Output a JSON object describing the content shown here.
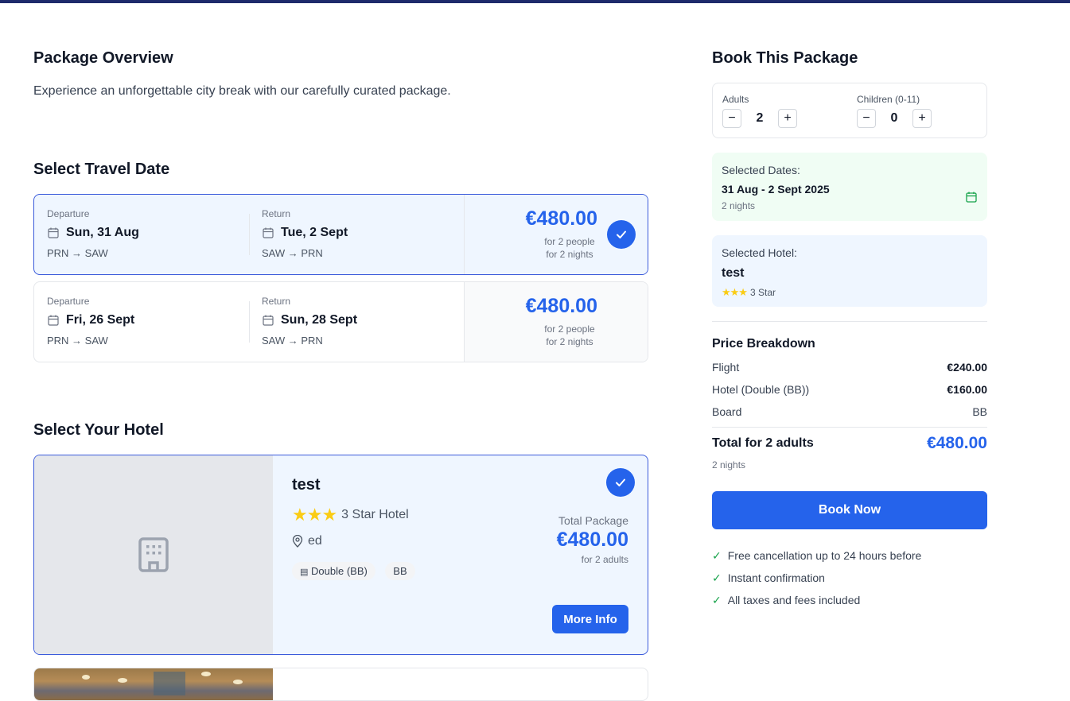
{
  "overview": {
    "title": "Package Overview",
    "description": "Experience an unforgettable city break with our carefully curated package."
  },
  "dates": {
    "title": "Select Travel Date",
    "options": [
      {
        "departure_label": "Departure",
        "departure_date": "Sun, 31 Aug",
        "departure_route": "PRN → SAW",
        "return_label": "Return",
        "return_date": "Tue, 2 Sept",
        "return_route": "SAW → PRN",
        "price": "€480.00",
        "people": "for 2 people",
        "nights": "for 2 nights",
        "selected": true
      },
      {
        "departure_label": "Departure",
        "departure_date": "Fri, 26 Sept",
        "departure_route": "PRN → SAW",
        "return_label": "Return",
        "return_date": "Sun, 28 Sept",
        "return_route": "SAW → PRN",
        "price": "€480.00",
        "people": "for 2 people",
        "nights": "for 2 nights",
        "selected": false
      }
    ]
  },
  "hotels": {
    "title": "Select Your Hotel",
    "items": [
      {
        "name": "test",
        "stars": 3,
        "star_label": "3 Star Hotel",
        "location": "ed",
        "room": "Double (BB)",
        "board": "BB",
        "total_label": "Total Package",
        "price": "€480.00",
        "price_note": "for 2 adults",
        "more_info": "More Info",
        "selected": true
      }
    ]
  },
  "booking": {
    "title": "Book This Package",
    "adults_label": "Adults",
    "adults_value": "2",
    "children_label": "Children (0-11)",
    "children_value": "0",
    "minus": "−",
    "plus": "+",
    "dates_label": "Selected Dates:",
    "dates_value": "31 Aug - 2 Sept 2025",
    "dates_nights": "2 nights",
    "hotel_label": "Selected Hotel:",
    "hotel_name": "test",
    "hotel_stars": 3,
    "hotel_star_label": "3 Star",
    "breakdown_title": "Price Breakdown",
    "breakdown": [
      {
        "label": "Flight",
        "value": "€240.00"
      },
      {
        "label": "Hotel (Double (BB))",
        "value": "€160.00"
      },
      {
        "label": "Board",
        "value": "BB"
      }
    ],
    "total_label": "Total for 2 adults",
    "total_value": "€480.00",
    "total_nights": "2 nights",
    "book_button": "Book Now",
    "features": [
      "Free cancellation up to 24 hours before",
      "Instant confirmation",
      "All taxes and fees included"
    ],
    "feature_tick": "✓"
  },
  "colors": {
    "accent": "#2563eb",
    "topbar": "#1e2a6b",
    "selected_bg": "#eff6ff",
    "dates_bg": "#f0fdf4",
    "star": "#facc15"
  }
}
